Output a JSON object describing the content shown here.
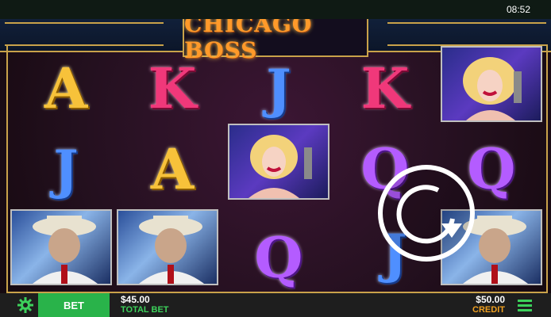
{
  "status_bar": {
    "time": "08:52"
  },
  "game": {
    "logo": "CHICAGO BOSS",
    "grid": [
      [
        "A",
        "K",
        "J",
        "K",
        "woman-portrait"
      ],
      [
        "J",
        "A",
        "woman-portrait",
        "Q",
        "Q"
      ],
      [
        "boss-portrait",
        "boss-portrait",
        "Q",
        "J",
        "boss-portrait"
      ]
    ]
  },
  "bottom_bar": {
    "settings_icon": "gear-icon",
    "bet_label": "BET",
    "total_bet_value": "$45.00",
    "total_bet_label": "TOTAL BET",
    "credit_value": "$50.00",
    "credit_label": "CREDIT",
    "menu_icon": "hamburger-menu-icon"
  },
  "colors": {
    "bet_button": "#29b34a",
    "total_bet_label": "#3cd15b",
    "credit_label": "#f0a020",
    "frame_gold": "#c9a24a"
  }
}
